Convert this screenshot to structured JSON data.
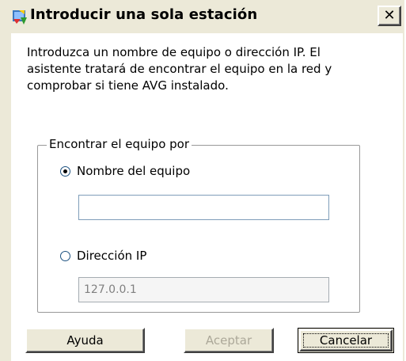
{
  "window": {
    "title": "Introducir una sola estación",
    "close_label": "✕"
  },
  "intro": {
    "text": "Introduzca un nombre de equipo o dirección IP. El asistente tratará de encontrar el equipo en la red y comprobar si tiene AVG instalado."
  },
  "group": {
    "legend": "Encontrar el equipo por",
    "options": [
      {
        "label": "Nombre del equipo",
        "checked": true
      },
      {
        "label": "Dirección IP",
        "checked": false
      }
    ],
    "name_input": {
      "value": ""
    },
    "ip_input": {
      "value": "127.0.0.1",
      "disabled": true
    }
  },
  "buttons": {
    "help": "Ayuda",
    "accept": "Aceptar",
    "cancel": "Cancelar"
  },
  "colors": {
    "dialog_face": "#ece9d8",
    "input_border": "#7f9db9",
    "disabled_text": "#aca899"
  },
  "icons": {
    "app": "avg-app-icon",
    "close": "close-icon"
  }
}
